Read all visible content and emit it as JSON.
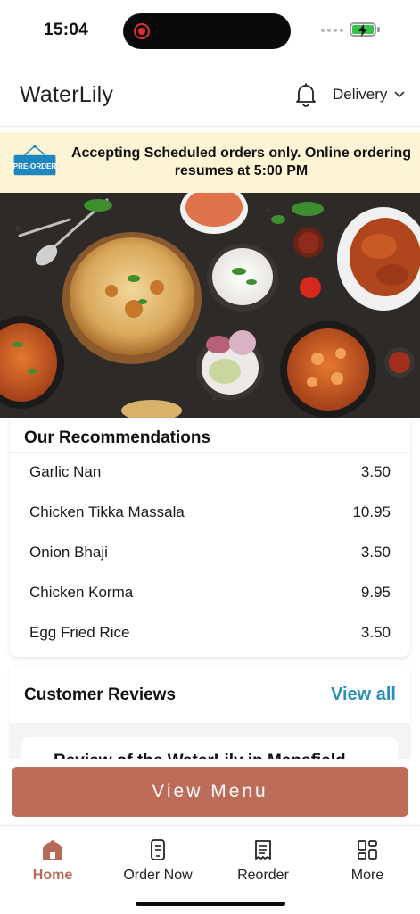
{
  "status_bar": {
    "time": "15:04"
  },
  "header": {
    "title": "WaterLily",
    "bell_icon": "bell-icon",
    "delivery_label": "Delivery",
    "chevron_icon": "chevron-down-icon"
  },
  "banner": {
    "badge_text": "PRE-ORDER",
    "message": "Accepting Scheduled orders only. Online ordering resumes at 5:00 PM"
  },
  "recommendations": {
    "title": "Our Recommendations",
    "items": [
      {
        "name": "Garlic Nan",
        "price": "3.50"
      },
      {
        "name": "Chicken Tikka Massala",
        "price": "10.95"
      },
      {
        "name": "Onion Bhaji",
        "price": "3.50"
      },
      {
        "name": "Chicken Korma",
        "price": "9.95"
      },
      {
        "name": "Egg Fried Rice",
        "price": "3.50"
      }
    ]
  },
  "reviews": {
    "title": "Customer Reviews",
    "view_all": "View all",
    "snippet": "Review of the WaterLily in Mansfield"
  },
  "cta": {
    "label": "View Menu"
  },
  "tabbar": {
    "tabs": [
      {
        "label": "Home",
        "icon": "home-icon",
        "active": true
      },
      {
        "label": "Order Now",
        "icon": "order-icon",
        "active": false
      },
      {
        "label": "Reorder",
        "icon": "receipt-icon",
        "active": false
      },
      {
        "label": "More",
        "icon": "grid-icon",
        "active": false
      }
    ]
  },
  "colors": {
    "accent": "#bd6c5a",
    "active_tab": "#b66a57",
    "link": "#2a8fb7",
    "banner_bg": "#fdf4d6",
    "badge_bg": "#1f87c0",
    "battery": "#36c24a"
  }
}
